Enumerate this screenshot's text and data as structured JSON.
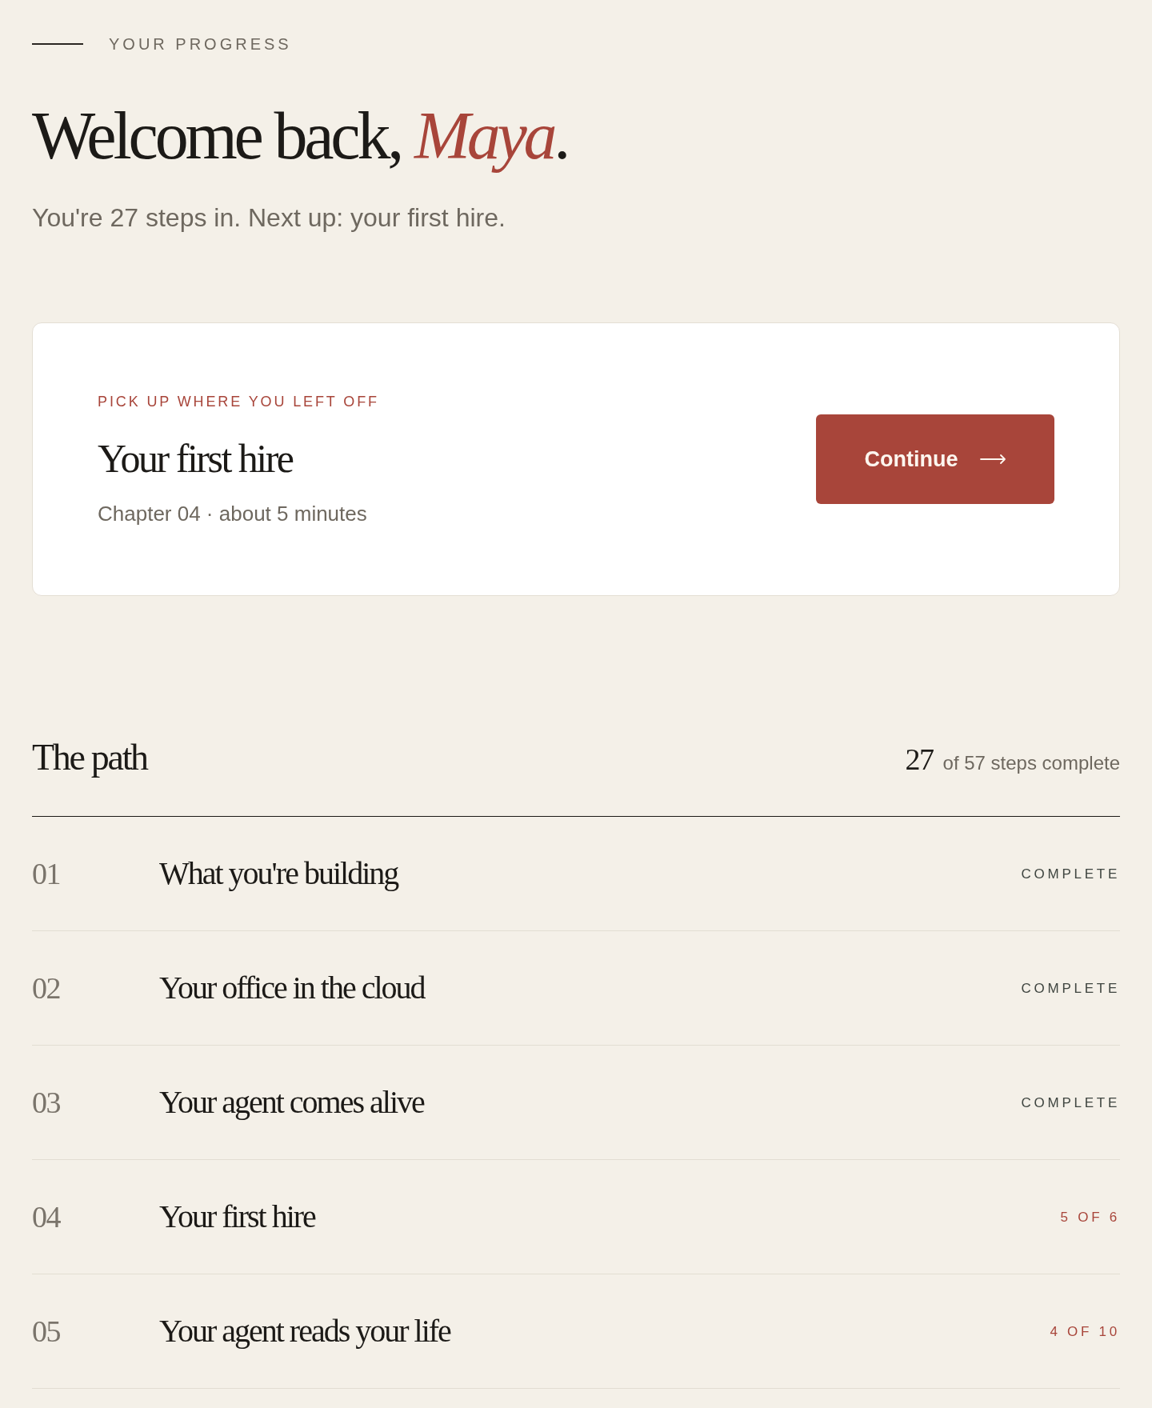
{
  "eyebrow": {
    "label": "YOUR PROGRESS"
  },
  "heading": {
    "lead": "Welcome back,",
    "name": "Maya",
    "end": "."
  },
  "subtitle": "You're 27 steps in. Next up: your first hire.",
  "resume_card": {
    "label": "PICK UP WHERE YOU LEFT OFF",
    "title": "Your first hire",
    "meta": "Chapter 04 · about 5 minutes",
    "button": "Continue"
  },
  "path": {
    "title": "The path",
    "steps_done": "27",
    "steps_label": "of 57 steps complete"
  },
  "chapters": [
    {
      "number": "01",
      "title": "What you're building",
      "status": "COMPLETE",
      "complete": true
    },
    {
      "number": "02",
      "title": "Your office in the cloud",
      "status": "COMPLETE",
      "complete": true
    },
    {
      "number": "03",
      "title": "Your agent comes alive",
      "status": "COMPLETE",
      "complete": true
    },
    {
      "number": "04",
      "title": "Your first hire",
      "status": "5 OF 6",
      "complete": false
    },
    {
      "number": "05",
      "title": "Your agent reads your life",
      "status": "4 OF 10",
      "complete": false
    }
  ]
}
